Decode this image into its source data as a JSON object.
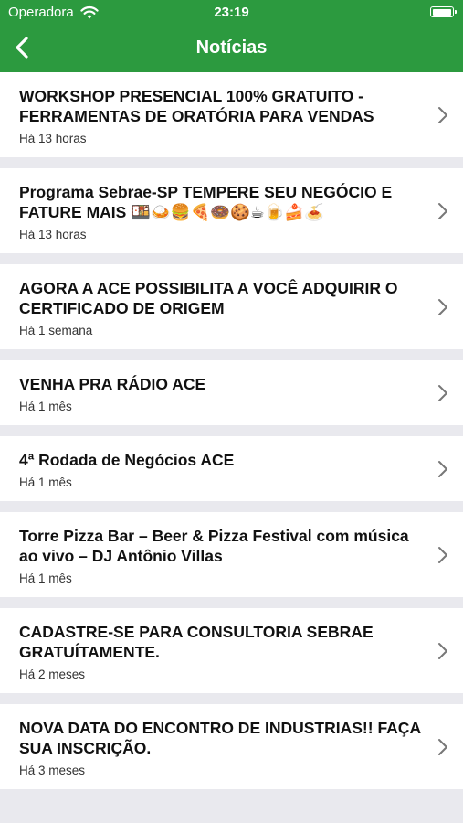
{
  "status": {
    "carrier": "Operadora",
    "time": "23:19"
  },
  "nav": {
    "title": "Notícias"
  },
  "news": [
    {
      "title": "WORKSHOP PRESENCIAL 100% GRATUITO - FERRAMENTAS DE ORATÓRIA PARA VENDAS",
      "time": "Há 13 horas"
    },
    {
      "title": "Programa Sebrae-SP TEMPERE SEU NEGÓCIO E FATURE MAIS 🍱🍛🍔🍕🍩🍪☕🍺🍰🍝",
      "time": "Há 13 horas"
    },
    {
      "title": "AGORA A ACE POSSIBILITA A VOCÊ ADQUIRIR O CERTIFICADO DE ORIGEM",
      "time": "Há 1 semana"
    },
    {
      "title": "VENHA PRA RÁDIO ACE",
      "time": "Há 1 mês"
    },
    {
      "title": "4ª Rodada de Negócios ACE",
      "time": "Há 1 mês"
    },
    {
      "title": "Torre Pizza Bar – Beer & Pizza Festival com música ao vivo – DJ Antônio Villas",
      "time": "Há 1 mês"
    },
    {
      "title": "CADASTRE-SE PARA CONSULTORIA SEBRAE GRATUÍTAMENTE.",
      "time": "Há 2 meses"
    },
    {
      "title": "NOVA DATA DO ENCONTRO DE INDUSTRIAS!! FAÇA SUA INSCRIÇÃO.",
      "time": "Há 3 meses"
    }
  ]
}
